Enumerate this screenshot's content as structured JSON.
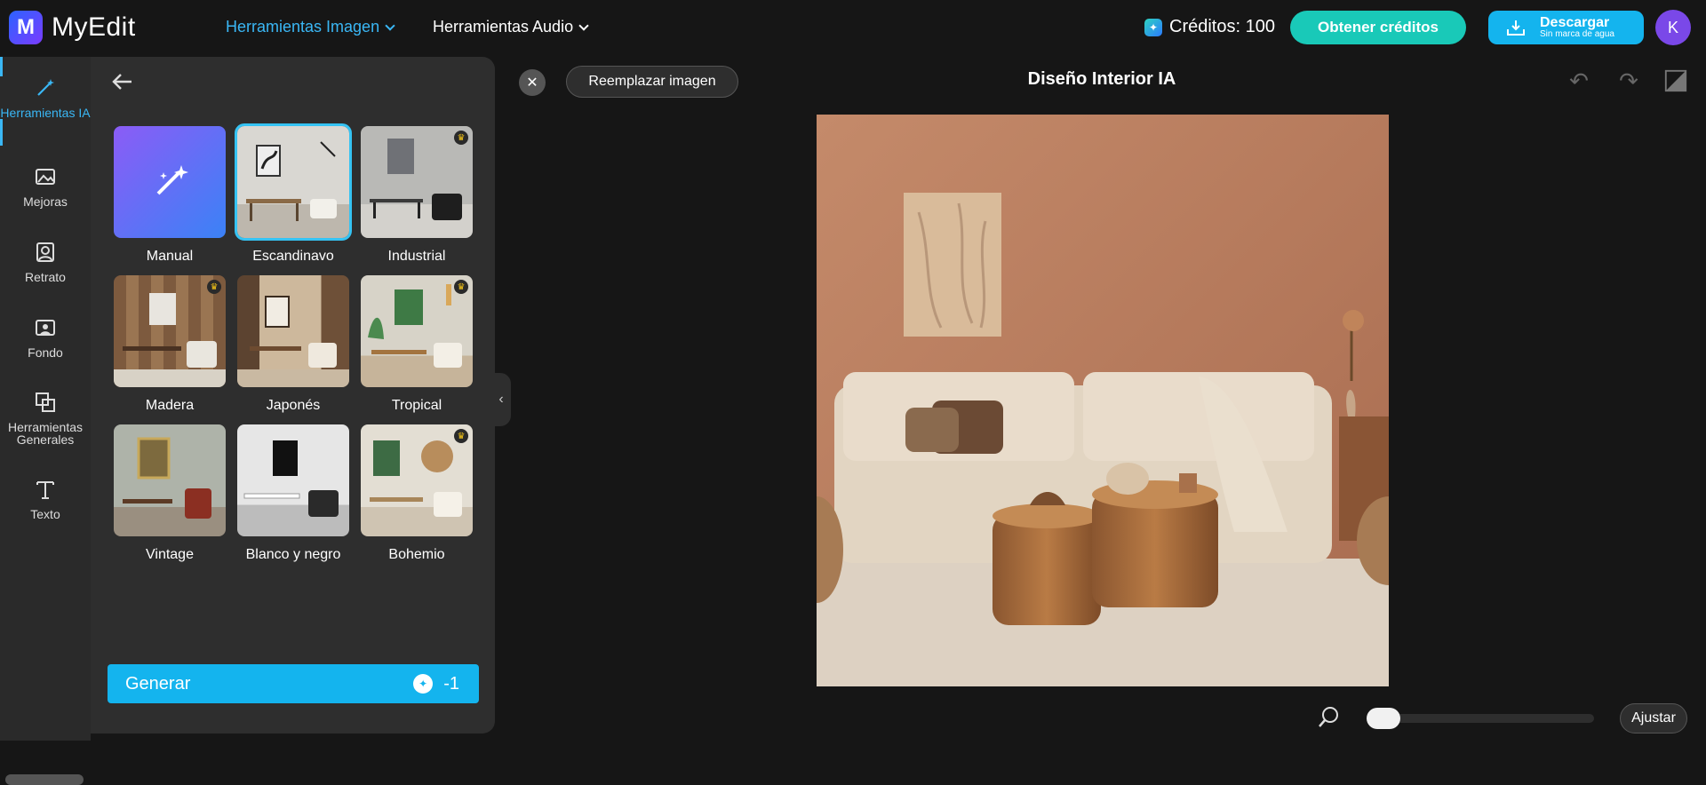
{
  "app": {
    "name": "MyEdit",
    "logo_letter": "M"
  },
  "topnav": {
    "image_tools": "Herramientas Imagen",
    "audio_tools": "Herramientas Audio",
    "credits_label": "Créditos: 100",
    "get_credits": "Obtener créditos",
    "download_main": "Descargar",
    "download_sub": "Sin marca de agua",
    "avatar_initial": "K"
  },
  "sidebar": {
    "items": [
      {
        "label": "Herramientas IA",
        "icon": "magic-wand-icon",
        "active": true
      },
      {
        "label": "Mejoras",
        "icon": "image-enhance-icon"
      },
      {
        "label": "Retrato",
        "icon": "portrait-icon"
      },
      {
        "label": "Fondo",
        "icon": "background-icon"
      },
      {
        "label": "Herramientas Generales",
        "icon": "general-tools-icon"
      },
      {
        "label": "Texto",
        "icon": "text-icon"
      }
    ]
  },
  "panel": {
    "styles": [
      {
        "label": "Manual",
        "premium": false
      },
      {
        "label": "Escandinavo",
        "premium": false,
        "selected": true
      },
      {
        "label": "Industrial",
        "premium": true
      },
      {
        "label": "Madera",
        "premium": true
      },
      {
        "label": "Japonés",
        "premium": false
      },
      {
        "label": "Tropical",
        "premium": true
      },
      {
        "label": "Vintage",
        "premium": false
      },
      {
        "label": "Blanco y negro",
        "premium": false
      },
      {
        "label": "Bohemio",
        "premium": true
      }
    ],
    "generate_label": "Generar",
    "generate_cost": "-1"
  },
  "editor": {
    "replace_image": "Reemplazar imagen",
    "title": "Diseño Interior IA",
    "fit_label": "Ajustar"
  },
  "colors": {
    "accent": "#14b4ee",
    "credits_button": "#19c9b8",
    "avatar": "#7a48e8"
  }
}
